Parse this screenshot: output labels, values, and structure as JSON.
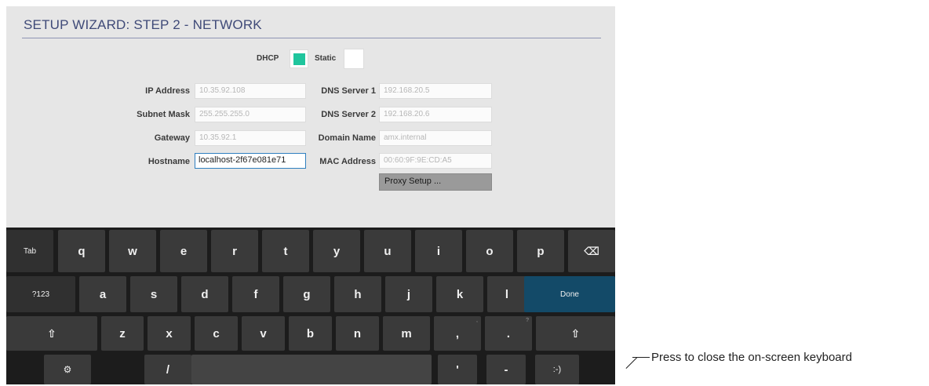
{
  "wizard": {
    "title": "SETUP WIZARD: STEP 2 - NETWORK"
  },
  "mode": {
    "dhcp_label": "DHCP",
    "static_label": "Static",
    "selected": "DHCP"
  },
  "fields": {
    "ip_address": {
      "label": "IP Address",
      "value": "10.35.92.108"
    },
    "subnet_mask": {
      "label": "Subnet Mask",
      "value": "255.255.255.0"
    },
    "gateway": {
      "label": "Gateway",
      "value": "10.35.92.1"
    },
    "hostname": {
      "label": "Hostname",
      "value": "localhost-2f67e081e71"
    },
    "dns_server_1": {
      "label": "DNS Server 1",
      "value": "192.168.20.5"
    },
    "dns_server_2": {
      "label": "DNS Server 2",
      "value": "192.168.20.6"
    },
    "domain_name": {
      "label": "Domain Name",
      "value": "amx.internal"
    },
    "mac_address": {
      "label": "MAC Address",
      "value": "00:60:9F:9E:CD:A5"
    }
  },
  "proxy_button": {
    "label": "Proxy Setup ..."
  },
  "keyboard": {
    "tab": "Tab",
    "row1": [
      "q",
      "w",
      "e",
      "r",
      "t",
      "y",
      "u",
      "i",
      "o",
      "p"
    ],
    "row2": [
      "a",
      "s",
      "d",
      "f",
      "g",
      "h",
      "j",
      "k",
      "l"
    ],
    "row3": [
      "z",
      "x",
      "c",
      "v",
      "b",
      "n",
      "m",
      ",",
      "."
    ],
    "row3_hints": [
      ",",
      "?"
    ],
    "symbols": "?123",
    "done": "Done",
    "slash": "/",
    "apostrophe": "'",
    "dash": "-",
    "smiley": ":-)",
    "shift_glyph": "⇧",
    "backspace_glyph": "⌫",
    "settings_glyph": "⚙"
  },
  "annotation": {
    "text": "Press to close the on-screen keyboard"
  }
}
